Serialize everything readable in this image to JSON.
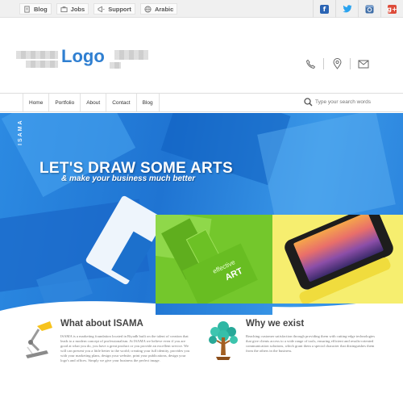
{
  "topbar": {
    "links": [
      {
        "label": "Blog",
        "icon": "document-icon"
      },
      {
        "label": "Jobs",
        "icon": "briefcase-icon"
      },
      {
        "label": "Support",
        "icon": "megaphone-icon"
      },
      {
        "label": "Arabic",
        "icon": "globe-icon"
      }
    ],
    "socials": [
      {
        "name": "facebook-icon",
        "glyph": "f",
        "color": "#2a64b4"
      },
      {
        "name": "twitter-icon",
        "glyph": "t",
        "color": "#2aa3ef"
      },
      {
        "name": "instagram-icon",
        "glyph": "◎",
        "color": "#3f6ea8"
      },
      {
        "name": "google-plus-icon",
        "glyph": "g+",
        "color": "#dd4b39"
      }
    ]
  },
  "header": {
    "logo": "Logo"
  },
  "nav": {
    "items": [
      "Home",
      "Portfolio",
      "About",
      "Contact",
      "Blog"
    ],
    "search_placeholder": "Type your search words"
  },
  "hero": {
    "brand": "ISAMA",
    "headline": "LET'S DRAW SOME ARTS",
    "subheadline": "& make your business much better",
    "card_text_top": "effective",
    "card_text_bottom": "ART"
  },
  "sections": {
    "about": {
      "title": "What about ISAMA",
      "text": "ISAMA is a marketing foundation located in Riyadh built on the talent of creation that leads to a modern concept of professionalism. At ISAMA we believe even if you are good at what you do, you have a great product or you provide an excellent service. We will can present you a little better to the world; creating your full identity, provides you with your marketing plans, design your website, print your publications, design your logo's and offices. Simply we give your business the perfect image."
    },
    "why": {
      "title": "Why we exist",
      "text": "Reaching customer satisfaction through providing them with cutting-edge technologies that give clients access to a wide range of tools, ensuring efficient and results-oriented communication solutions, which grant them a special character that distinguishes them from the others in the business."
    }
  },
  "colors": {
    "accent": "#2f7fd1",
    "hero_blue": "#1f74d2",
    "green": "#74c72c",
    "yellow": "#f6ee6f"
  }
}
